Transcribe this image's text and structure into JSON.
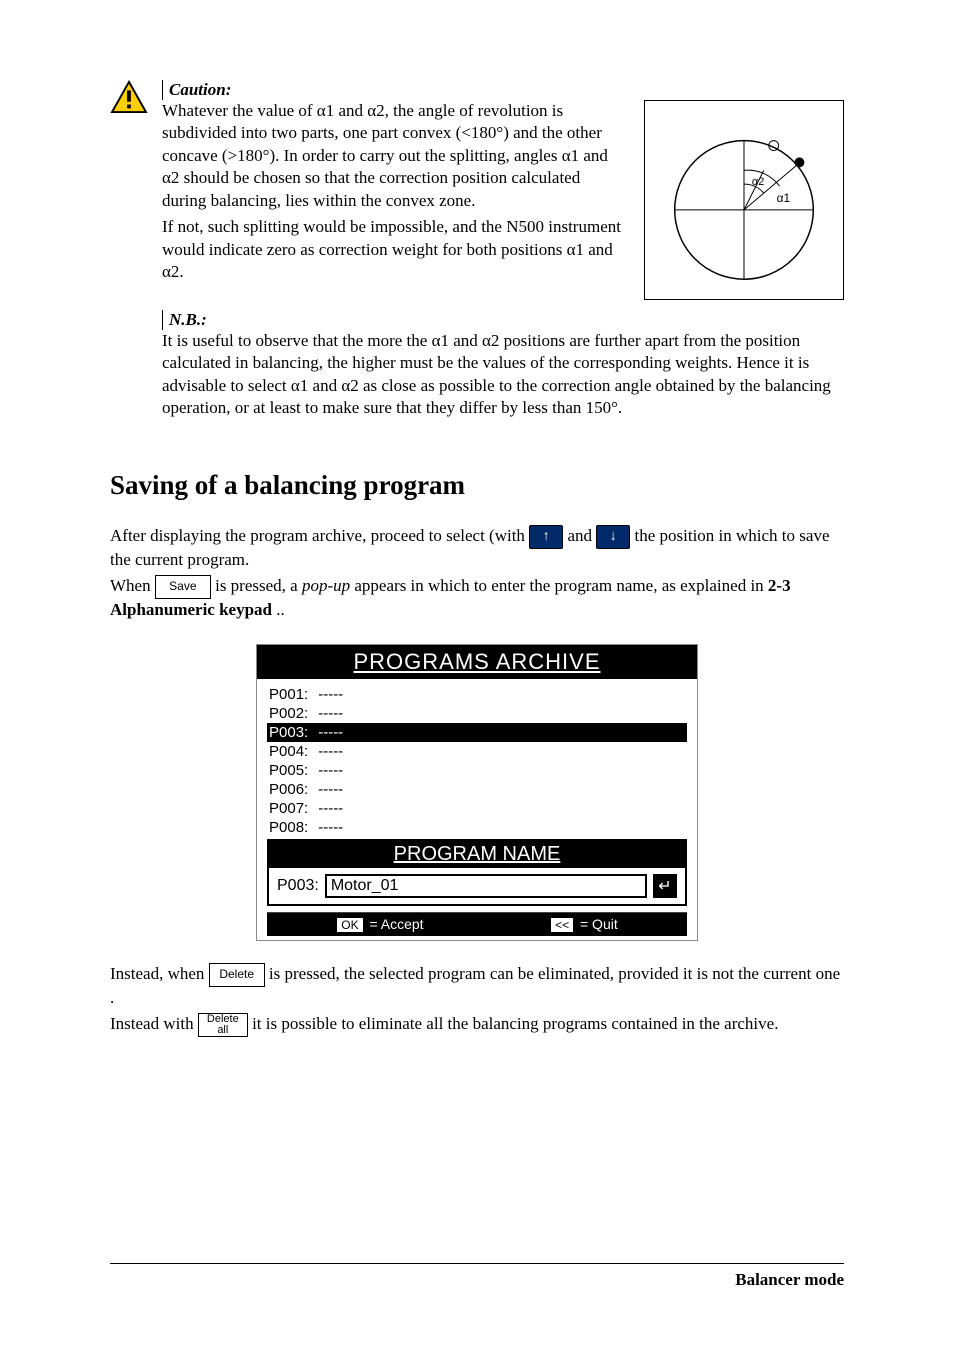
{
  "caution": {
    "heading": "Caution:",
    "para1": "Whatever the value of α1 and α2, the angle of revolution is subdivided into two parts, one part convex (<180°) and the other concave (>180°). In order to carry out the splitting, angles α1 and α2 should be chosen so that the correction position calculated during balancing,  lies within the convex zone.",
    "para2": "If not, such splitting would be impossible, and the N500 instrument would indicate zero as correction weight for both positions α1 and α2.",
    "fig_labels": {
      "alpha1": "α1",
      "alpha2": "α2"
    }
  },
  "nb": {
    "heading": "N.B.:",
    "text": "It is useful to observe that the more the α1 and α2 positions are further apart from the position calculated in balancing, the higher must be the values of the corresponding weights. Hence it is advisable to select α1 and α2 as close as possible to the correction angle obtained by the balancing operation, or at least to make sure that they differ by less than 150°."
  },
  "section_title": "Saving of a balancing program",
  "body": {
    "t1a": "After displaying the program archive, proceed to select  (with ",
    "t1b": " and ",
    "t1c": "  the position in which to save the current program.",
    "t2a": "When  ",
    "t2b": "  is pressed,  a ",
    "t2c_italic": "pop-up",
    "t2d": " appears in which to enter the program name, as explained in ",
    "t2e_bold": "2-3 Alphanumeric keypad",
    "t2f": "..",
    "t3a": "Instead, when  ",
    "t3b": "  is pressed, the selected program can be eliminated,  provided it is not the current one .",
    "t4a": "Instead with  ",
    "t4b": "  it is possible to eliminate all the balancing programs contained in the archive."
  },
  "keys": {
    "up": "↑",
    "down": "↓",
    "save": "Save",
    "delete": "Delete",
    "delete_all_line1": "Delete",
    "delete_all_line2": "all"
  },
  "screenshot": {
    "title": "PROGRAMS ARCHIVE",
    "rows": [
      {
        "id": "P001:",
        "val": "-----",
        "sel": false
      },
      {
        "id": "P002:",
        "val": "-----",
        "sel": false
      },
      {
        "id": "P003:",
        "val": "-----",
        "sel": true
      },
      {
        "id": "P004:",
        "val": "-----",
        "sel": false
      },
      {
        "id": "P005:",
        "val": "-----",
        "sel": false
      },
      {
        "id": "P006:",
        "val": "-----",
        "sel": false
      },
      {
        "id": "P007:",
        "val": "-----",
        "sel": false
      },
      {
        "id": "P008:",
        "val": "-----",
        "sel": false
      }
    ],
    "popup_title": "PROGRAM NAME",
    "popup_prefix": "P003:",
    "popup_value": "Motor_01",
    "return_glyph": "↵",
    "footer_ok_key": "OK",
    "footer_ok_txt": " = Accept",
    "footer_quit_key": "<<",
    "footer_quit_txt": " = Quit"
  },
  "footer": "Balancer mode"
}
